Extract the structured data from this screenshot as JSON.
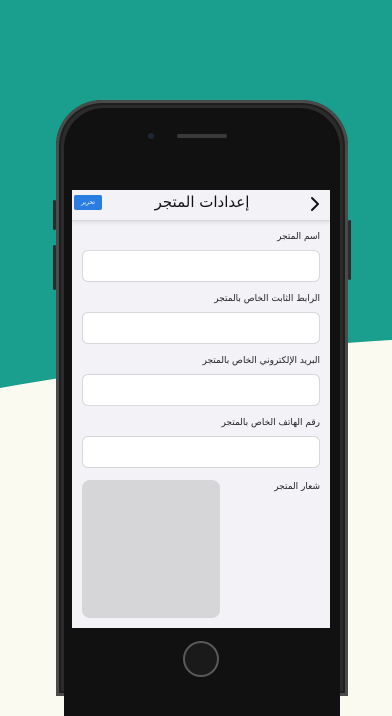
{
  "colors": {
    "teal": "#1a9e8e",
    "cream": "#fbfaf1",
    "accent_blue": "#2a7de1"
  },
  "navbar": {
    "title": "إعدادات المتجر",
    "edit_label": "تحرير",
    "back_icon": "chevron-right-icon"
  },
  "form": {
    "store_name_label": "اسم المتجر",
    "store_name_value": "",
    "permalink_label": "الرابط الثابت الخاص بالمتجر",
    "permalink_value": "",
    "email_label": "البريد الإلكتروني الخاص بالمتجر",
    "email_value": "",
    "phone_label": "رقم الهاتف الخاص بالمتجر",
    "phone_value": "",
    "logo_label": "شعار المتجر"
  }
}
